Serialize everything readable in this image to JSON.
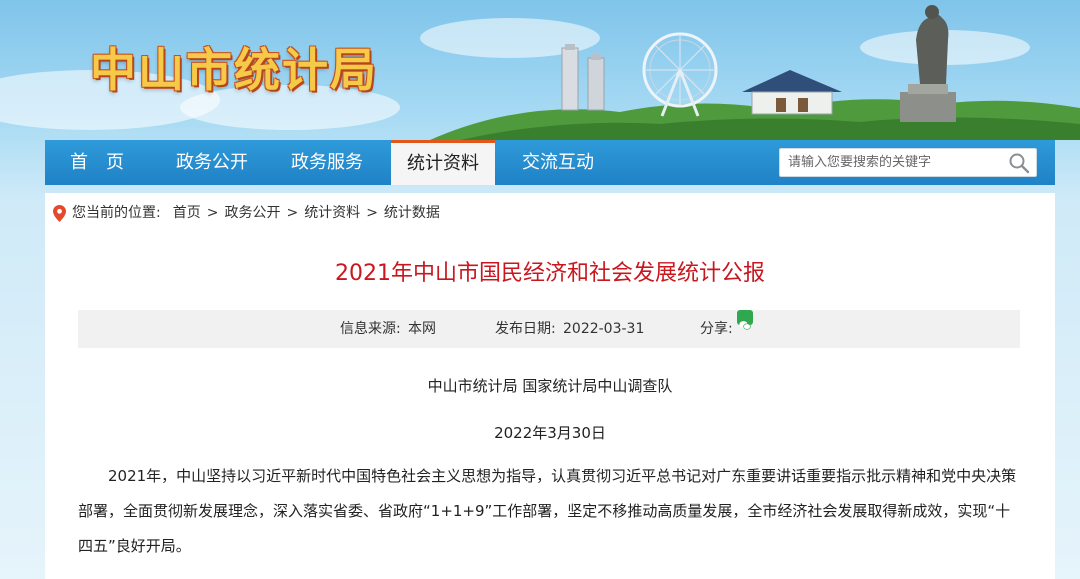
{
  "header": {
    "site_title": "中山市统计局"
  },
  "nav": {
    "items": [
      {
        "label": "首　页"
      },
      {
        "label": "政务公开"
      },
      {
        "label": "政务服务"
      },
      {
        "label": "统计资料",
        "active": true
      },
      {
        "label": "交流互动"
      }
    ],
    "search_placeholder": "请输入您要搜索的关键字"
  },
  "breadcrumb": {
    "prefix": "您当前的位置:",
    "items": [
      "首页",
      "政务公开",
      "统计资料",
      "统计数据"
    ],
    "separator": ">"
  },
  "article": {
    "title": "2021年中山市国民经济和社会发展统计公报",
    "meta": {
      "source_label": "信息来源:",
      "source": "本网",
      "date_label": "发布日期:",
      "date": "2022-03-31",
      "share_label": "分享:"
    },
    "issuer": "中山市统计局  国家统计局中山调查队",
    "issue_date": "2022年3月30日",
    "paragraph": "2021年，中山坚持以习近平新时代中国特色社会主义思想为指导，认真贯彻习近平总书记对广东重要讲话重要指示批示精神和党中央决策部署，全面贯彻新发展理念，深入落实省委、省政府“1+1+9”工作部署，坚定不移推动高质量发展，全市经济社会发展取得新成效，实现“十四五”良好开局。"
  },
  "colors": {
    "nav_blue": "#1f82c6",
    "title_red": "#c8171e",
    "active_tab_border": "#e4571b",
    "title_gold": "#f7c948"
  },
  "icons": [
    "location-pin-icon",
    "search-icon",
    "wechat-icon"
  ]
}
